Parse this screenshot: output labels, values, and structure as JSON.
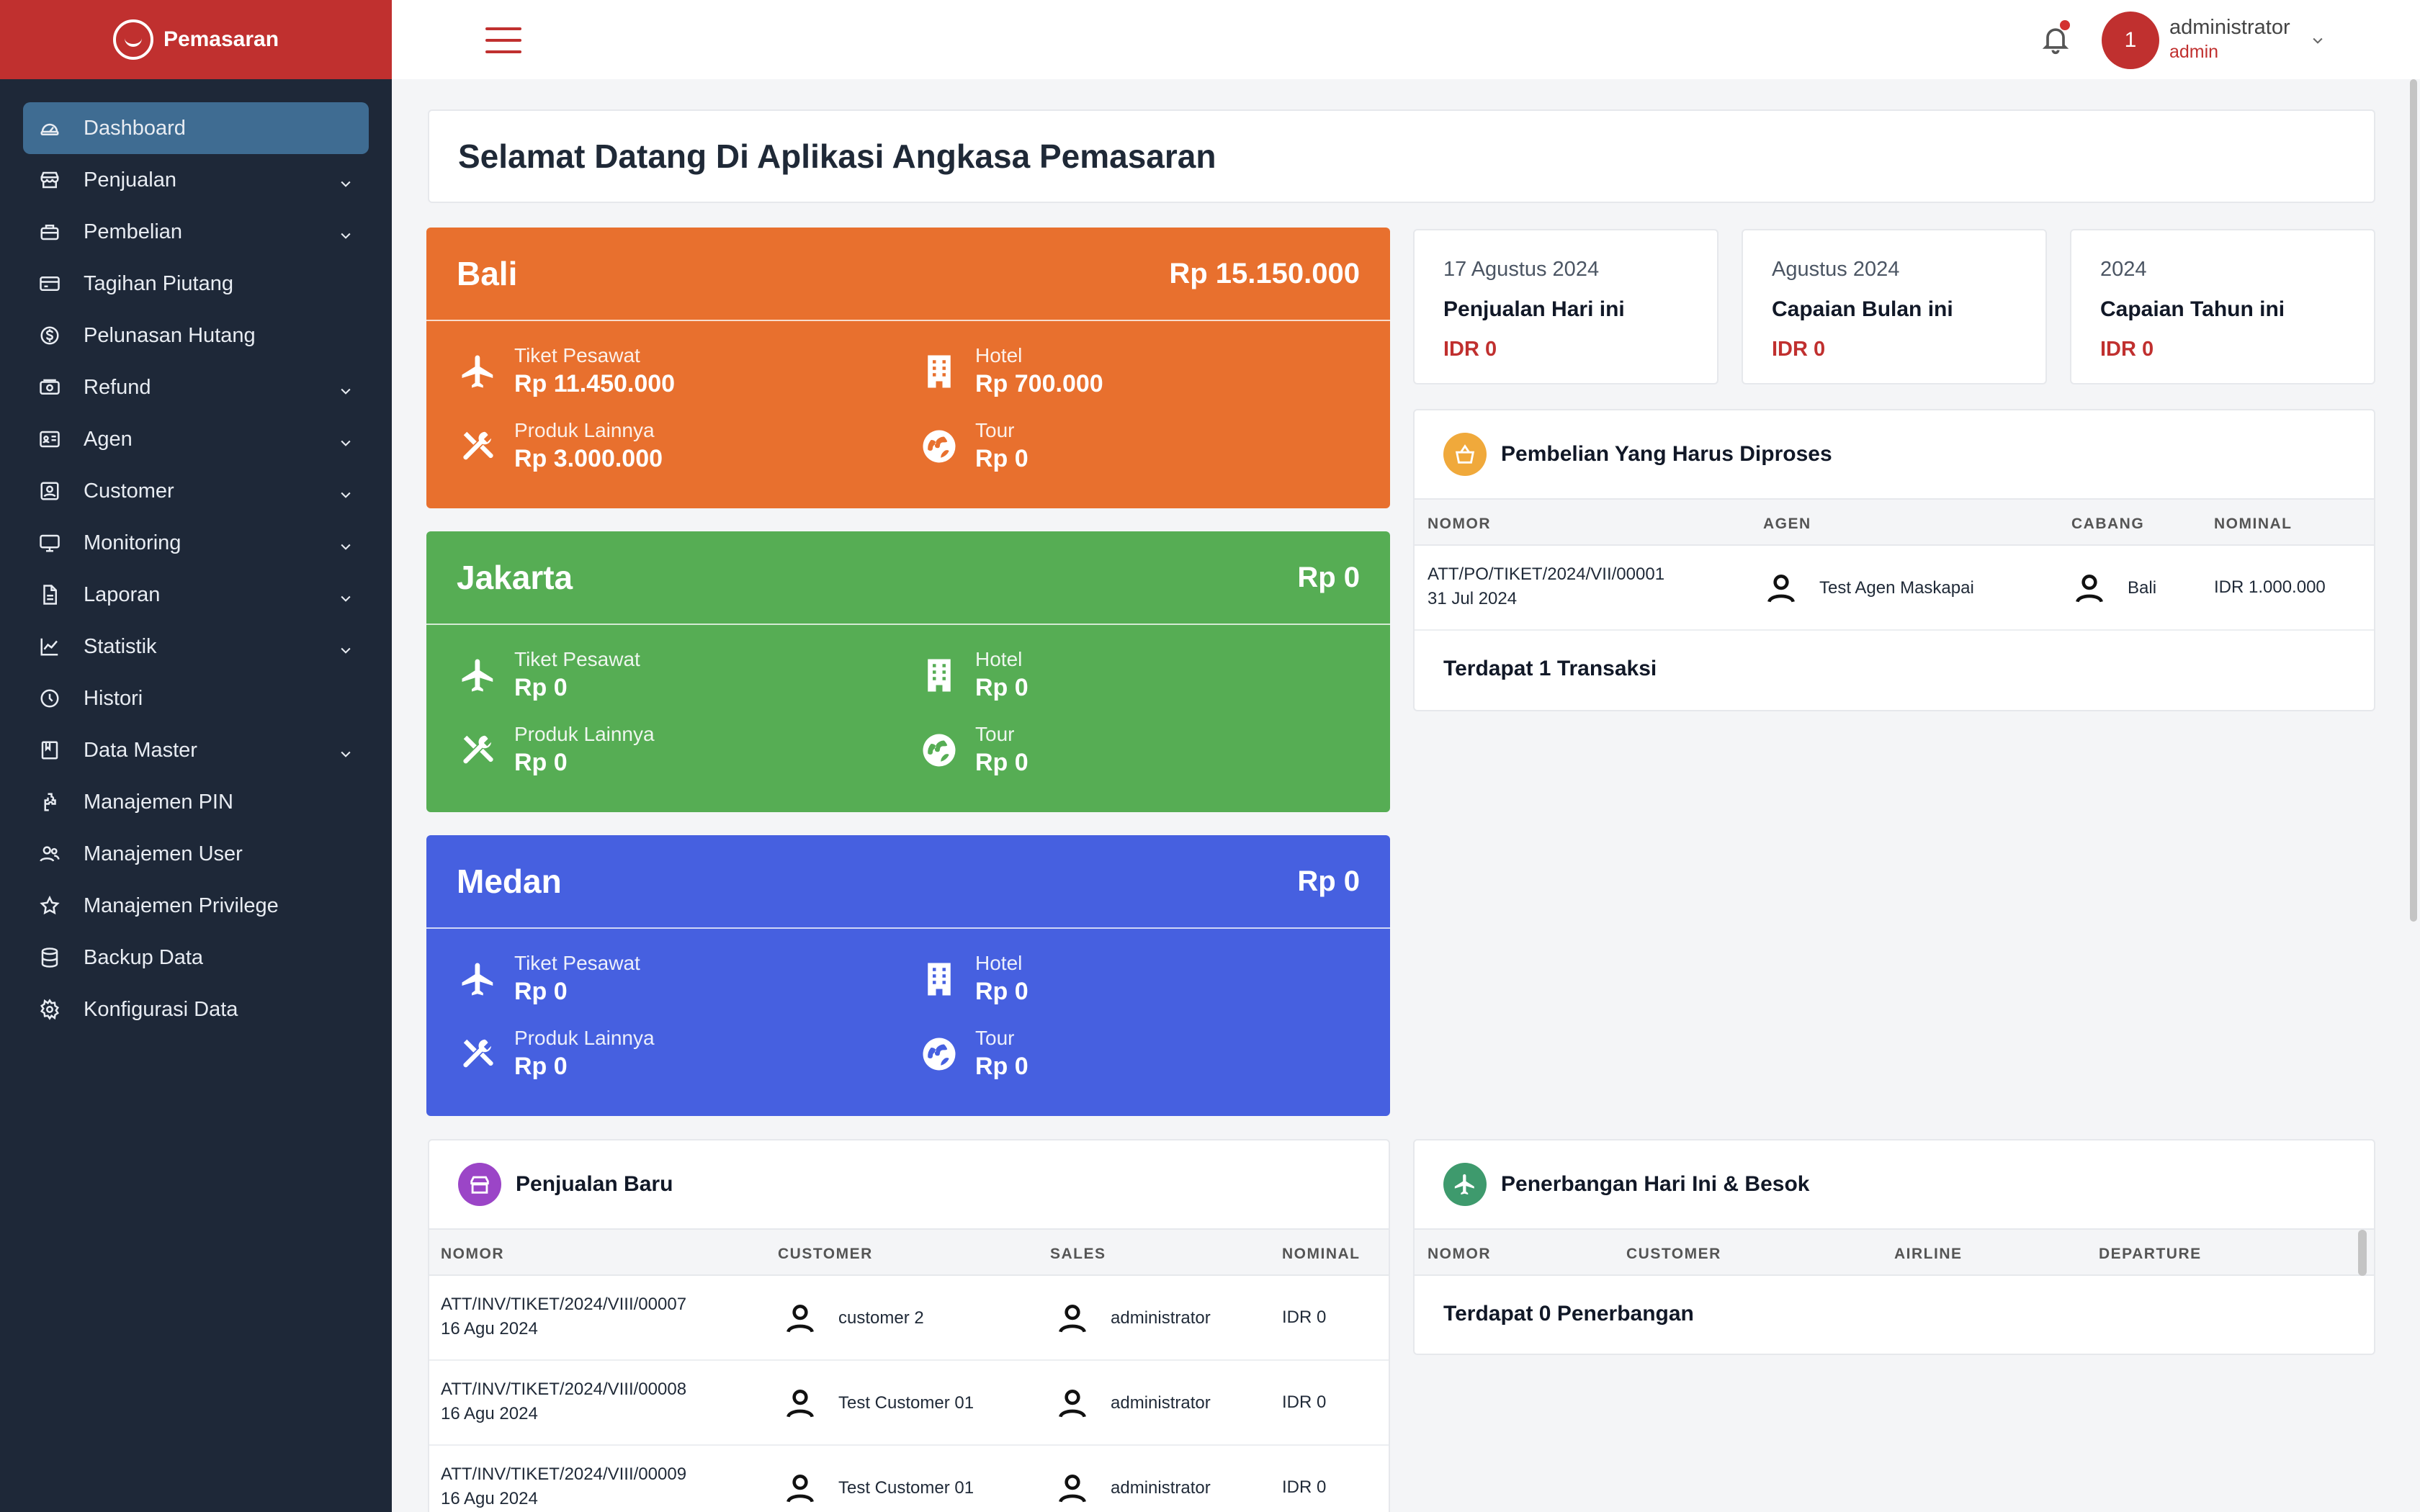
{
  "brand": {
    "name": "Pemasaran"
  },
  "sidebar": {
    "items": [
      {
        "label": "Dashboard",
        "icon": "gauge-icon",
        "has_children": false,
        "active": true
      },
      {
        "label": "Penjualan",
        "icon": "store-icon",
        "has_children": true
      },
      {
        "label": "Pembelian",
        "icon": "basket-icon",
        "has_children": true
      },
      {
        "label": "Tagihan Piutang",
        "icon": "credit-card-icon",
        "has_children": false
      },
      {
        "label": "Pelunasan Hutang",
        "icon": "dollar-circle-icon",
        "has_children": false
      },
      {
        "label": "Refund",
        "icon": "cash-icon",
        "has_children": true
      },
      {
        "label": "Agen",
        "icon": "id-card-icon",
        "has_children": true
      },
      {
        "label": "Customer",
        "icon": "contact-card-icon",
        "has_children": true
      },
      {
        "label": "Monitoring",
        "icon": "monitor-icon",
        "has_children": true
      },
      {
        "label": "Laporan",
        "icon": "document-icon",
        "has_children": true
      },
      {
        "label": "Statistik",
        "icon": "line-chart-icon",
        "has_children": true
      },
      {
        "label": "Histori",
        "icon": "clock-icon",
        "has_children": false
      },
      {
        "label": "Data Master",
        "icon": "book-icon",
        "has_children": true
      },
      {
        "label": "Manajemen PIN",
        "icon": "pin-puzzle-icon",
        "has_children": false
      },
      {
        "label": "Manajemen User",
        "icon": "users-icon",
        "has_children": false
      },
      {
        "label": "Manajemen Privilege",
        "icon": "star-icon",
        "has_children": false
      },
      {
        "label": "Backup Data",
        "icon": "database-icon",
        "has_children": false
      },
      {
        "label": "Konfigurasi Data",
        "icon": "gear-icon",
        "has_children": false
      }
    ]
  },
  "topbar": {
    "avatar_initial": "1",
    "user_name": "administrator",
    "user_role": "admin"
  },
  "welcome": {
    "title": "Selamat Datang Di Aplikasi Angkasa Pemasaran"
  },
  "regions": [
    {
      "name": "Bali",
      "total": "Rp 15.150.000",
      "color": "#e8702e",
      "tiket_label": "Tiket Pesawat",
      "tiket": "Rp 11.450.000",
      "hotel_label": "Hotel",
      "hotel": "Rp 700.000",
      "produk_label": "Produk Lainnya",
      "produk": "Rp 3.000.000",
      "tour_label": "Tour",
      "tour": "Rp 0"
    },
    {
      "name": "Jakarta",
      "total": "Rp 0",
      "color": "#56ad54",
      "tiket_label": "Tiket Pesawat",
      "tiket": "Rp 0",
      "hotel_label": "Hotel",
      "hotel": "Rp 0",
      "produk_label": "Produk Lainnya",
      "produk": "Rp 0",
      "tour_label": "Tour",
      "tour": "Rp 0"
    },
    {
      "name": "Medan",
      "total": "Rp 0",
      "color": "#4660e0",
      "tiket_label": "Tiket Pesawat",
      "tiket": "Rp 0",
      "hotel_label": "Hotel",
      "hotel": "Rp 0",
      "produk_label": "Produk Lainnya",
      "produk": "Rp 0",
      "tour_label": "Tour",
      "tour": "Rp 0"
    }
  ],
  "summary": [
    {
      "date": "17 Agustus 2024",
      "title": "Penjualan Hari ini",
      "value": "IDR 0"
    },
    {
      "date": "Agustus 2024",
      "title": "Capaian Bulan ini",
      "value": "IDR 0"
    },
    {
      "date": "2024",
      "title": "Capaian Tahun ini",
      "value": "IDR 0"
    }
  ],
  "pembelian": {
    "title": "Pembelian Yang Harus Diproses",
    "icon_color": "#f0a93b",
    "columns": [
      "NOMOR",
      "AGEN",
      "CABANG",
      "NOMINAL"
    ],
    "rows": [
      {
        "nomor": "ATT/PO/TIKET/2024/VII/00001",
        "tanggal": "31 Jul 2024",
        "agen": "Test Agen Maskapai",
        "cabang": "Bali",
        "nominal": "IDR 1.000.000"
      }
    ],
    "footer": "Terdapat 1 Transaksi"
  },
  "penjualan_baru": {
    "title": "Penjualan Baru",
    "icon_color": "#9b45c7",
    "columns": [
      "NOMOR",
      "CUSTOMER",
      "SALES",
      "NOMINAL"
    ],
    "rows": [
      {
        "nomor": "ATT/INV/TIKET/2024/VIII/00007",
        "tanggal": "16 Agu 2024",
        "customer": "customer 2",
        "sales": "administrator",
        "nominal": "IDR 0"
      },
      {
        "nomor": "ATT/INV/TIKET/2024/VIII/00008",
        "tanggal": "16 Agu 2024",
        "customer": "Test Customer 01",
        "sales": "administrator",
        "nominal": "IDR 0"
      },
      {
        "nomor": "ATT/INV/TIKET/2024/VIII/00009",
        "tanggal": "16 Agu 2024",
        "customer": "Test Customer 01",
        "sales": "administrator",
        "nominal": "IDR 0"
      }
    ]
  },
  "penerbangan": {
    "title": "Penerbangan Hari Ini & Besok",
    "icon_color": "#3e9a6d",
    "columns": [
      "NOMOR",
      "CUSTOMER",
      "AIRLINE",
      "DEPARTURE"
    ],
    "footer": "Terdapat 0 Penerbangan"
  }
}
